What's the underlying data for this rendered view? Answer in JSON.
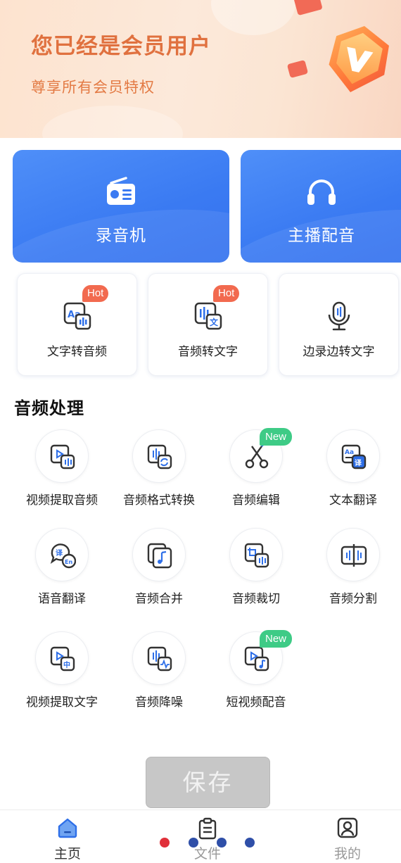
{
  "banner": {
    "title": "您已经是会员用户",
    "subtitle": "尊享所有会员特权"
  },
  "main_cards": [
    {
      "label": "录音机",
      "icon": "radio-icon"
    },
    {
      "label": "主播配音",
      "icon": "headphones-icon"
    }
  ],
  "feature_cards": [
    {
      "label": "文字转音频",
      "badge": "Hot",
      "icon": "text-to-audio-icon"
    },
    {
      "label": "音频转文字",
      "badge": "Hot",
      "icon": "audio-to-text-icon"
    },
    {
      "label": "边录边转文字",
      "badge": "",
      "icon": "microphone-icon"
    }
  ],
  "audio_section": {
    "title": "音频处理",
    "tools": [
      {
        "label": "视频提取音频",
        "badge": "",
        "icon": "video-extract-audio-icon"
      },
      {
        "label": "音频格式转换",
        "badge": "",
        "icon": "audio-format-convert-icon"
      },
      {
        "label": "音频编辑",
        "badge": "New",
        "icon": "scissors-icon"
      },
      {
        "label": "文本翻译",
        "badge": "",
        "icon": "text-translate-icon"
      },
      {
        "label": "语音翻译",
        "badge": "",
        "icon": "voice-translate-icon"
      },
      {
        "label": "音频合并",
        "badge": "",
        "icon": "audio-merge-icon"
      },
      {
        "label": "音频裁切",
        "badge": "",
        "icon": "audio-crop-icon"
      },
      {
        "label": "音频分割",
        "badge": "",
        "icon": "audio-split-icon"
      },
      {
        "label": "视频提取文字",
        "badge": "",
        "icon": "video-extract-text-icon"
      },
      {
        "label": "音频降噪",
        "badge": "",
        "icon": "audio-denoise-icon"
      },
      {
        "label": "短视频配音",
        "badge": "New",
        "icon": "short-video-dub-icon"
      }
    ]
  },
  "save_button": {
    "label": "保存"
  },
  "bottom_nav": [
    {
      "label": "主页",
      "icon": "home-icon",
      "active": true
    },
    {
      "label": "文件",
      "icon": "clipboard-icon",
      "active": false
    },
    {
      "label": "我的",
      "icon": "profile-icon",
      "active": false
    }
  ],
  "overlay_dots": [
    "#e0303a",
    "#2f4fa8",
    "#2f4fa8",
    "#2f4fa8"
  ],
  "colors": {
    "accent_blue": "#3a7af2",
    "banner_text": "#e0713f",
    "hot_badge": "#f26a4f",
    "new_badge": "#3ecb86"
  }
}
